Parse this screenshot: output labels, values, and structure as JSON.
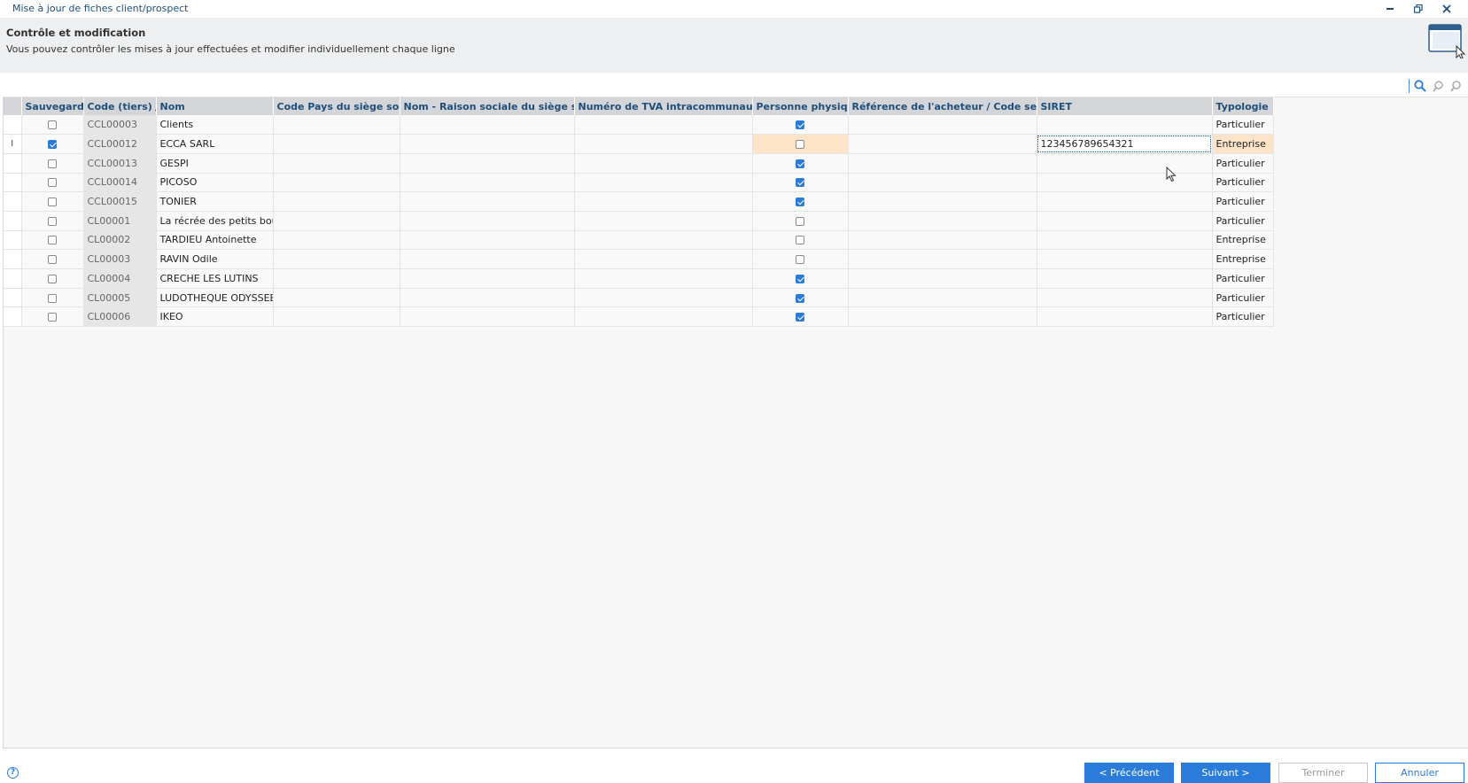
{
  "window": {
    "title": "Mise à jour de fiches client/prospect"
  },
  "header": {
    "title": "Contrôle et modification",
    "subtitle": "Vous pouvez contrôler les mises à jour effectuées et modifier individuellement chaque ligne"
  },
  "grid": {
    "columns": [
      "Sauvegarder",
      "Code (tiers)",
      "Nom",
      "Code Pays du siège social",
      "Nom - Raison sociale du siège social",
      "Numéro de TVA intracommunautaire",
      "Personne physique",
      "Référence de l'acheteur / Code service",
      "SIRET",
      "Typologie"
    ],
    "rows": [
      {
        "indicator": "",
        "save": false,
        "code": "CCL00003",
        "nom": "Clients",
        "pays": "",
        "raison": "",
        "tva": "",
        "physique": true,
        "ref": "",
        "siret": "",
        "typologie": "Particulier"
      },
      {
        "indicator": "I",
        "save": true,
        "code": "CCL00012",
        "nom": "ECCA SARL",
        "pays": "",
        "raison": "",
        "tva": "",
        "physique": false,
        "ref": "",
        "siret": "123456789654321",
        "typologie": "Entreprise"
      },
      {
        "indicator": "",
        "save": false,
        "code": "CCL00013",
        "nom": "GESPI",
        "pays": "",
        "raison": "",
        "tva": "",
        "physique": true,
        "ref": "",
        "siret": "",
        "typologie": "Particulier"
      },
      {
        "indicator": "",
        "save": false,
        "code": "CCL00014",
        "nom": "PICOSO",
        "pays": "",
        "raison": "",
        "tva": "",
        "physique": true,
        "ref": "",
        "siret": "",
        "typologie": "Particulier"
      },
      {
        "indicator": "",
        "save": false,
        "code": "CCL00015",
        "nom": "TONIER",
        "pays": "",
        "raison": "",
        "tva": "",
        "physique": true,
        "ref": "",
        "siret": "",
        "typologie": "Particulier"
      },
      {
        "indicator": "",
        "save": false,
        "code": "CL00001",
        "nom": "La récrée des petits bouts",
        "pays": "",
        "raison": "",
        "tva": "",
        "physique": false,
        "ref": "",
        "siret": "",
        "typologie": "Particulier"
      },
      {
        "indicator": "",
        "save": false,
        "code": "CL00002",
        "nom": "TARDIEU Antoinette",
        "pays": "",
        "raison": "",
        "tva": "",
        "physique": false,
        "ref": "",
        "siret": "",
        "typologie": "Entreprise"
      },
      {
        "indicator": "",
        "save": false,
        "code": "CL00003",
        "nom": "RAVIN Odile",
        "pays": "",
        "raison": "",
        "tva": "",
        "physique": false,
        "ref": "",
        "siret": "",
        "typologie": "Entreprise"
      },
      {
        "indicator": "",
        "save": false,
        "code": "CL00004",
        "nom": "CRECHE LES LUTINS",
        "pays": "",
        "raison": "",
        "tva": "",
        "physique": true,
        "ref": "",
        "siret": "",
        "typologie": "Particulier"
      },
      {
        "indicator": "",
        "save": false,
        "code": "CL00005",
        "nom": "LUDOTHEQUE ODYSSEE",
        "pays": "",
        "raison": "",
        "tva": "",
        "physique": true,
        "ref": "",
        "siret": "",
        "typologie": "Particulier"
      },
      {
        "indicator": "",
        "save": false,
        "code": "CL00006",
        "nom": "IKEO",
        "pays": "",
        "raison": "",
        "tva": "",
        "physique": true,
        "ref": "",
        "siret": "",
        "typologie": "Particulier"
      }
    ]
  },
  "footer": {
    "help": "?",
    "prev_label": "< Précédent",
    "next_label": "Suivant >",
    "finish_label": "Terminer",
    "cancel_label": "Annuler"
  },
  "colors": {
    "accent": "#2b7bdb",
    "header_text": "#1f4e79",
    "highlight": "#fde3c8"
  }
}
